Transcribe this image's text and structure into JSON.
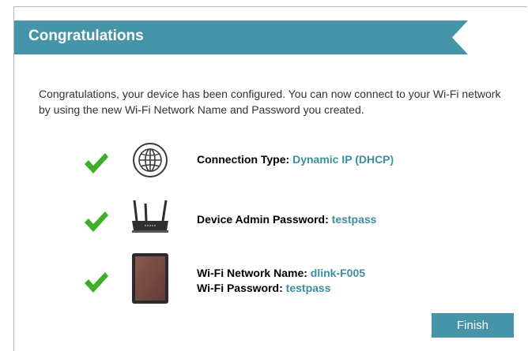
{
  "dialog": {
    "title": "Congratulations",
    "intro": "Congratulations, your device has been configured. You can now connect to your Wi-Fi network by using the new Wi-Fi Network Name and Password you created.",
    "colors": {
      "accent": "#4594a7",
      "value_text": "#3b8ea3",
      "check": "#3fae2a"
    }
  },
  "summary": {
    "connection": {
      "icon": "globe-icon",
      "label": "Connection Type:",
      "value": "Dynamic IP (DHCP)"
    },
    "admin": {
      "icon": "router-icon",
      "label": "Device Admin Password:",
      "value": "testpass"
    },
    "wifi": {
      "icon": "tablet-icon",
      "name_label": "Wi-Fi Network Name:",
      "name_value": "dlink-F005",
      "password_label": "Wi-Fi Password:",
      "password_value": "testpass"
    }
  },
  "actions": {
    "finish_label": "Finish"
  }
}
